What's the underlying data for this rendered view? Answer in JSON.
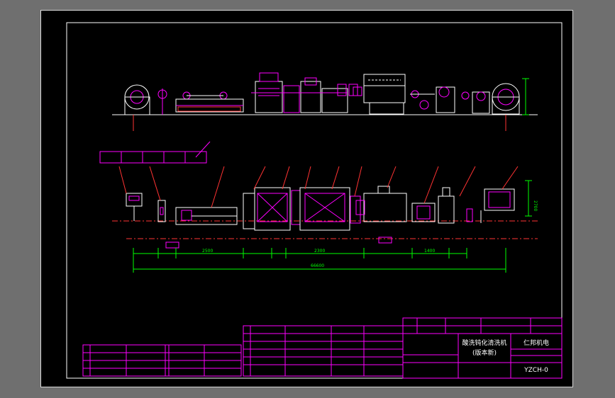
{
  "colors": {
    "background": "#6f6f6f",
    "sheet": "#000000",
    "border": "#ffffff",
    "machine": "#ffffff",
    "accent": "#ff00ff",
    "dimension": "#00ff00",
    "leader": "#ff3333"
  },
  "title_block": {
    "drawing_name_line1": "酸洗钝化清洗机",
    "drawing_name_line2": "(版本新)",
    "company": "仁邦机电",
    "drawing_number": "YZCH-0"
  },
  "dimensions": {
    "total_length": "66600",
    "segment_a": "2500",
    "segment_b": "2300",
    "segment_c": "1400",
    "side_height": "2700"
  }
}
